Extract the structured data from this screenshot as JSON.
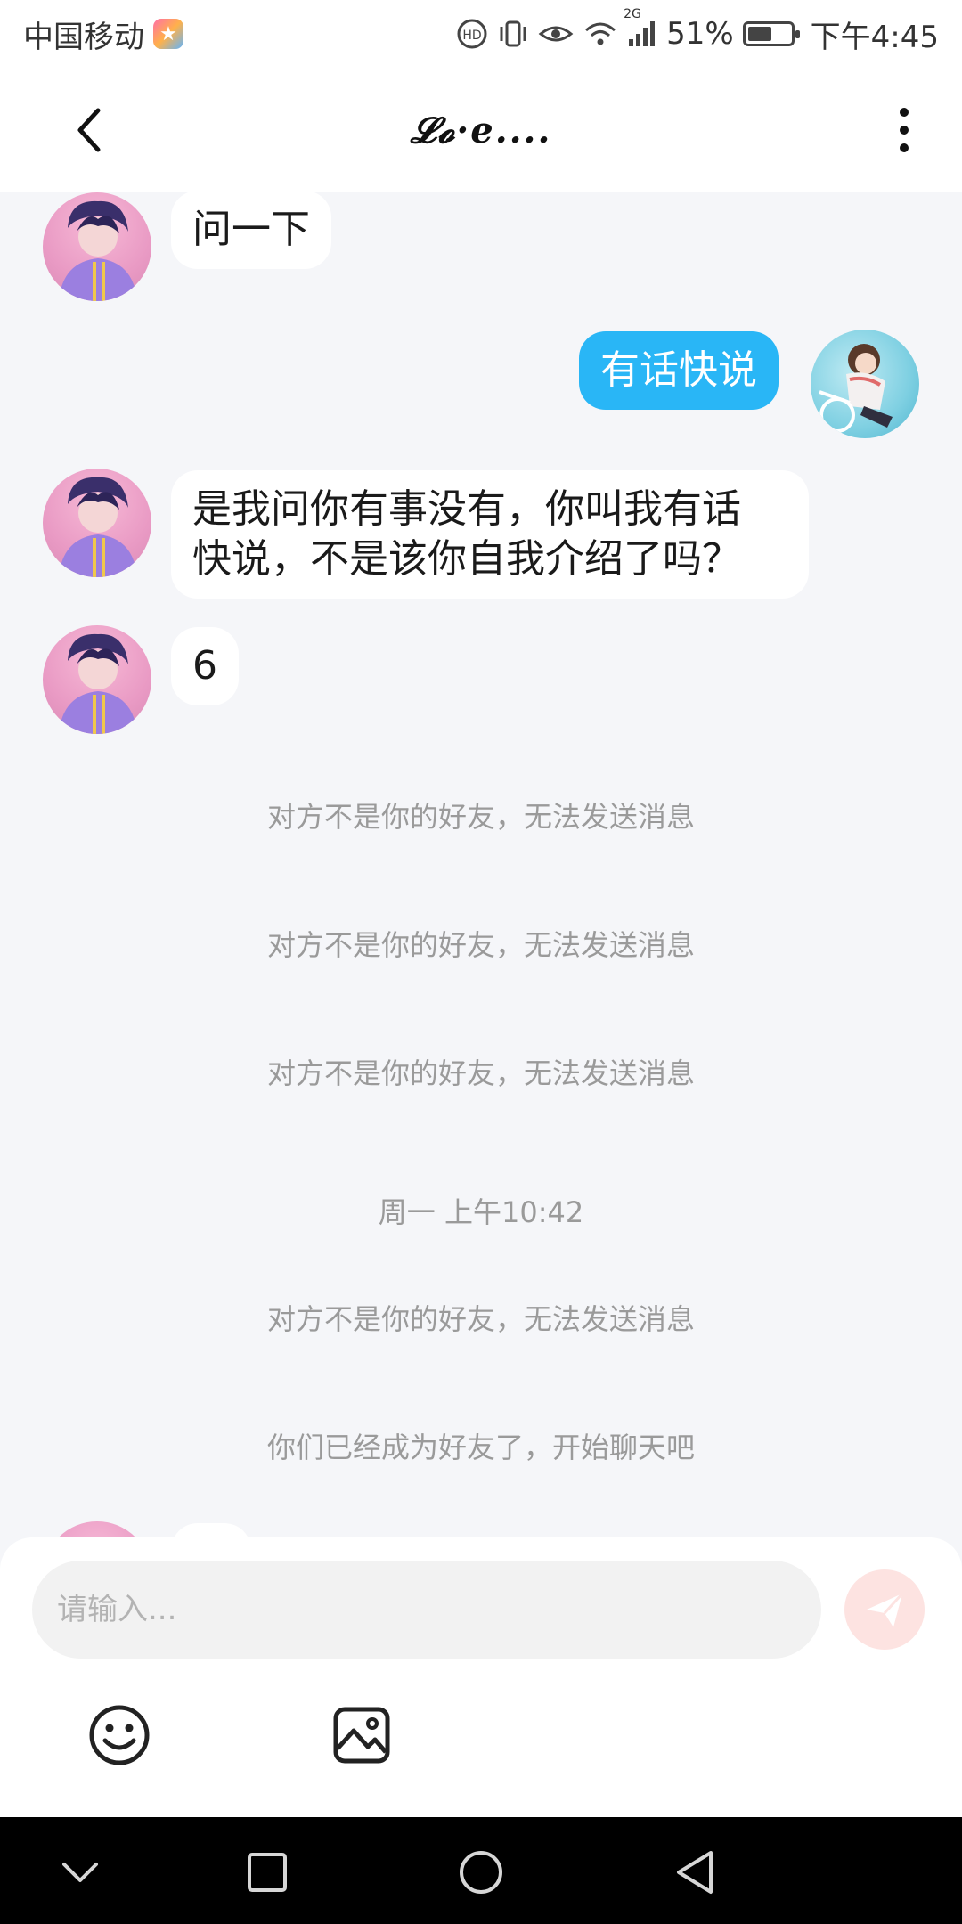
{
  "status_bar": {
    "carrier": "中国移动",
    "network": "2G",
    "battery": "51%",
    "time": "下午4:45",
    "icons": [
      "hd-icon",
      "vibrate-icon",
      "eye-icon",
      "wifi-icon",
      "signal-icon",
      "battery-icon"
    ]
  },
  "header": {
    "title": "𝓛𝓸·e....",
    "back_icon": "chevron-left-icon",
    "more_icon": "more-vertical-icon"
  },
  "messages": [
    {
      "from": "other",
      "text": "问一下"
    },
    {
      "from": "me",
      "text": "有话快说"
    },
    {
      "from": "other",
      "lines": [
        "是我问你有事没有，你叫我有话",
        "快说，不是该你自我介绍了吗？"
      ]
    },
    {
      "from": "other",
      "text": "6"
    }
  ],
  "system": {
    "not_friend_1": "对方不是你的好友，无法发送消息",
    "not_friend_2": "对方不是你的好友，无法发送消息",
    "not_friend_3": "对方不是你的好友，无法发送消息",
    "timestamp": "周一 上午10:42",
    "not_friend_4": "对方不是你的好友，无法发送消息",
    "became_friends": "你们已经成为好友了，开始聊天吧"
  },
  "input": {
    "placeholder": "请输入...",
    "send_icon": "send-icon",
    "emoji_icon": "smiley-icon",
    "image_icon": "image-icon"
  },
  "colors": {
    "out_bubble": "#29b6f6",
    "send_button": "#fde3e1",
    "background": "#f5f6f9"
  }
}
